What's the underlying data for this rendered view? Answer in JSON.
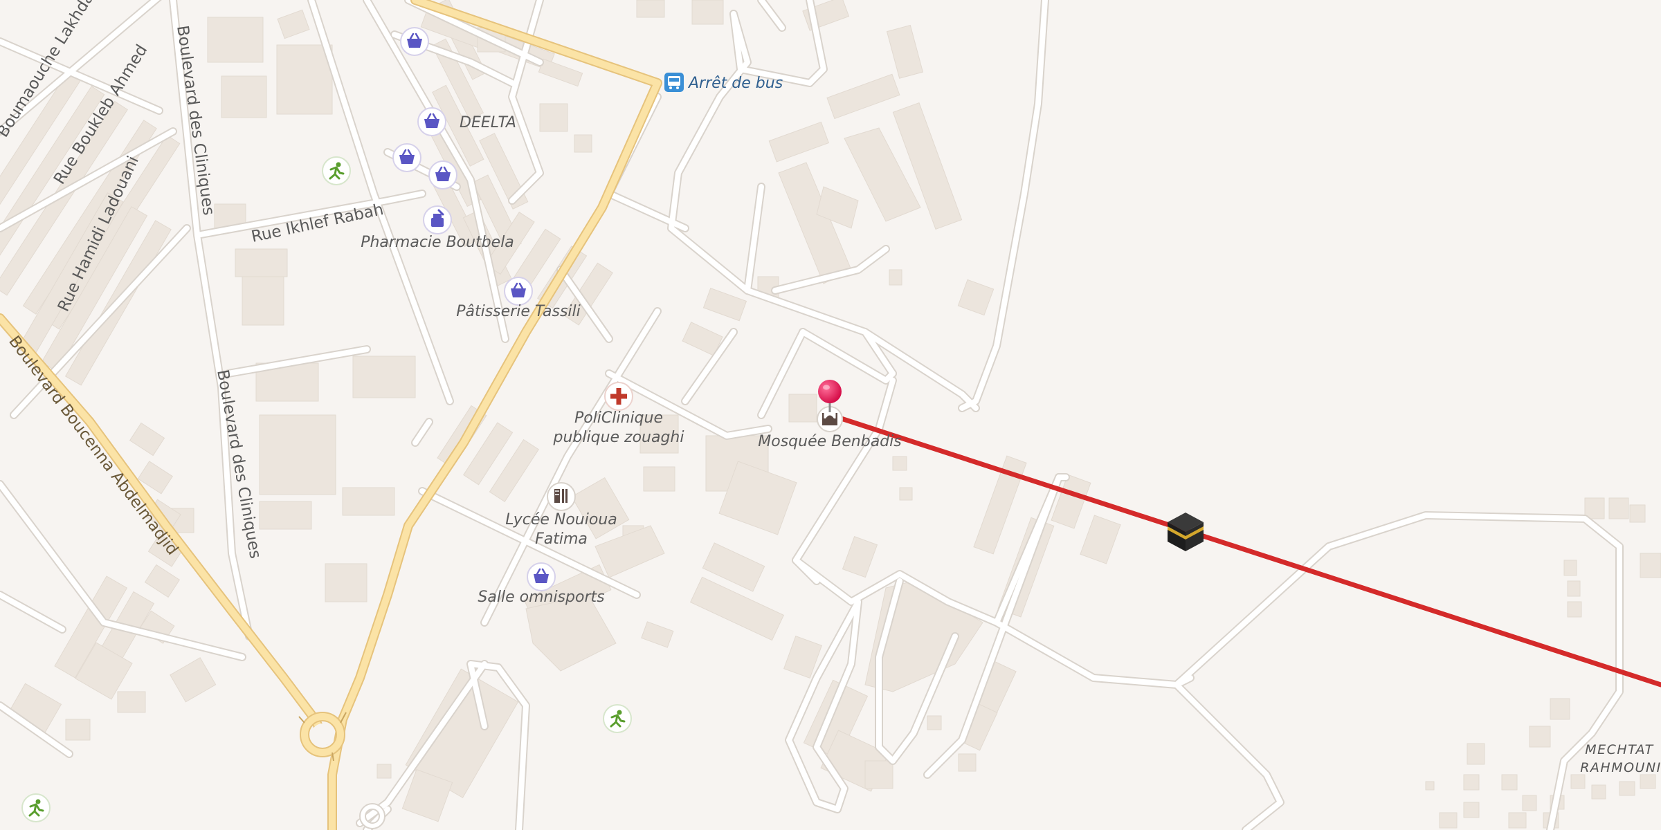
{
  "map": {
    "colors": {
      "background": "#f7f4f1",
      "building": "#ece5dd",
      "minor_road": "#ffffff",
      "minor_road_casing": "#d9d3cc",
      "primary_road": "#fbe3a6",
      "primary_road_casing": "#e6c37c",
      "route_line": "#d42a2a",
      "pin": "#e8195a",
      "shop_icon": "#5a56c4",
      "health_icon": "#c0392b",
      "leisure_icon": "#5a9e2e",
      "bus_icon": "#3a8fd6"
    },
    "streets": {
      "boulevard_des_cliniques_1": "Boulevard des Cliniques",
      "boulevard_des_cliniques_2": "Boulevard des Cliniques",
      "rue_boukleb": "Rue Boukleb Ahmed",
      "rue_boumaouche": "Boumaouche Lakhdar",
      "rue_hamidi": "Rue Hamidi Ladouani",
      "rue_ikhlef": "Rue Ikhlef Rabah",
      "boulevard_boucenna": "Boulevard Boucenna Abdelmadjid"
    },
    "pois": {
      "bus_stop": "Arrêt de bus",
      "deelta": "DEELTA",
      "pharmacie": "Pharmacie Boutbela",
      "patisserie": "Pâtisserie Tassili",
      "policlinique_1": "PoliClinique",
      "policlinique_2": "publique zouaghi",
      "mosquee": "Mosquée Benbadis",
      "lycee_1": "Lycée Nouioua",
      "lycee_2": "Fatima",
      "salle": "Salle omnisports",
      "locality_1": "MECHTAT",
      "locality_2": "RAHMOUNI"
    },
    "icons": {
      "shop": "shopping-basket-icon",
      "pharmacy": "pharmacy-icon",
      "clinic": "medical-cross-icon",
      "mosque": "mosque-icon",
      "school": "school-icon",
      "sports": "sports-runner-icon",
      "bus": "bus-stop-icon",
      "kaaba": "kaaba-qibla-icon",
      "pin": "location-pin-icon"
    },
    "route": {
      "name": "qibla direction line"
    }
  }
}
